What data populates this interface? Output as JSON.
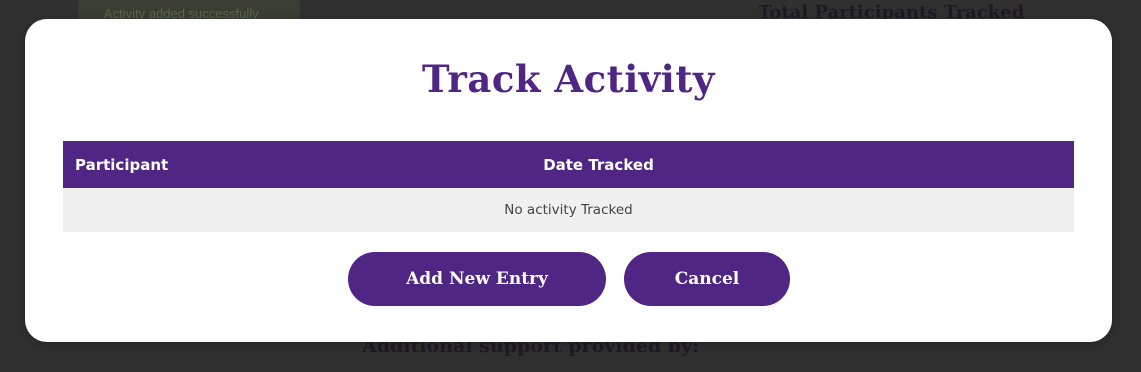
{
  "background": {
    "toast_text": "Activity added successfully",
    "top_heading": "Total Participants Tracked",
    "bottom_heading": "Additional support provided by:"
  },
  "modal": {
    "title": "Track Activity",
    "table": {
      "columns": [
        "Participant",
        "Date Tracked"
      ],
      "empty_message": "No activity Tracked"
    },
    "buttons": {
      "add_label": "Add New Entry",
      "cancel_label": "Cancel"
    }
  },
  "colors": {
    "accent": "#4f2683",
    "overlay": "#2b2b2b",
    "empty_row": "#f0f0f0"
  }
}
